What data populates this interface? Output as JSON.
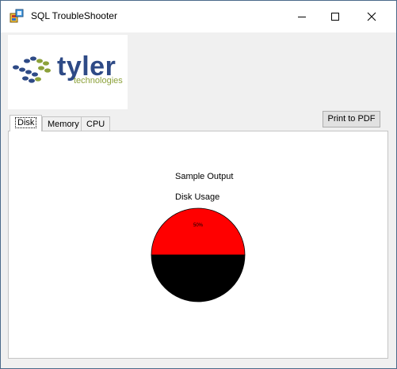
{
  "window": {
    "title": "SQL TroubleShooter",
    "controls": {
      "minimize": "minimize-icon",
      "maximize": "maximize-icon",
      "close": "close-icon"
    }
  },
  "logo": {
    "word": "tyler",
    "sub": "technologies",
    "brand_blue": "#2e4a86",
    "brand_green": "#8ca13a"
  },
  "toolbar": {
    "print_label": "Print to PDF"
  },
  "tabs": [
    {
      "label": "Disk",
      "active": true
    },
    {
      "label": "Memory",
      "active": false
    },
    {
      "label": "CPU",
      "active": false
    }
  ],
  "disk_panel": {
    "heading": "Sample Output",
    "subheading": "Disk Usage",
    "pie_label": "50%",
    "chart_data": {
      "type": "pie",
      "values": [
        50,
        50
      ],
      "colors": [
        "#ff0000",
        "#000000"
      ]
    }
  }
}
